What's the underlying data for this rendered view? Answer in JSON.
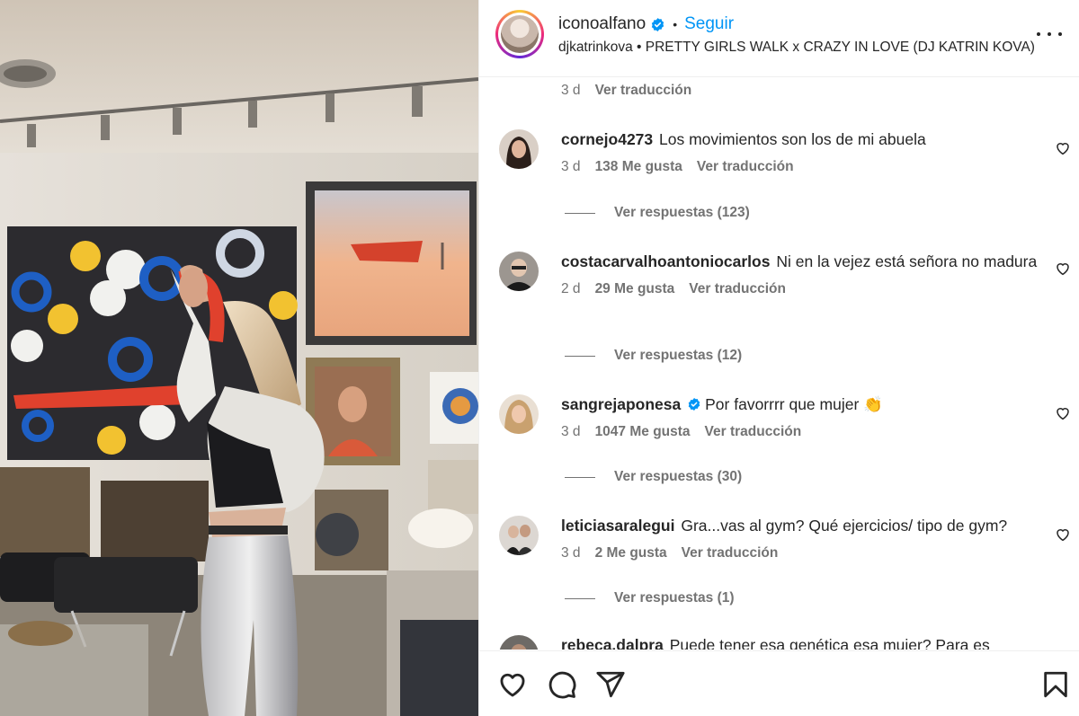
{
  "header": {
    "username": "iconoalfano",
    "separator": "•",
    "follow_label": "Seguir",
    "audio": "djkatrinkova • PRETTY GIRLS WALK x CRAZY IN LOVE (DJ KATRIN KOVA)"
  },
  "top_meta": {
    "time": "3 d",
    "translate": "Ver traducción"
  },
  "comments": [
    {
      "username": "cornejo4273",
      "text": "Los movimientos son los de mi abuela",
      "verified": false,
      "time": "3 d",
      "likes": "138 Me gusta",
      "translate": "Ver traducción",
      "replies": "Ver respuestas (123)"
    },
    {
      "username": "costacarvalhoantoniocarlos",
      "text": "Ni en la vejez está señora no madura",
      "verified": false,
      "time": "2 d",
      "likes": "29 Me gusta",
      "translate": "Ver traducción",
      "replies": "Ver respuestas (12)"
    },
    {
      "username": "sangrejaponesa",
      "text": "Por favorrrr que mujer 👏",
      "verified": true,
      "time": "3 d",
      "likes": "1047 Me gusta",
      "translate": "Ver traducción",
      "replies": "Ver respuestas (30)"
    },
    {
      "username": "leticiasaralegui",
      "text": "Gra...vas al gym? Qué ejercicios/ tipo de gym?",
      "verified": false,
      "time": "3 d",
      "likes": "2 Me gusta",
      "translate": "Ver traducción",
      "replies": "Ver respuestas (1)"
    }
  ],
  "partial_comment": {
    "username": "rebeca.dalpra",
    "text": "Puede tener esa genética esa mujer? Para es"
  },
  "icons": {
    "like": "heart-icon",
    "comment": "comment-icon",
    "share": "share-icon",
    "save": "bookmark-icon",
    "more": "more-options-icon",
    "verified": "verified-badge-icon"
  },
  "colors": {
    "accent": "#0095f6",
    "text": "#262626",
    "secondary": "#737373",
    "verified": "#0095f6"
  }
}
